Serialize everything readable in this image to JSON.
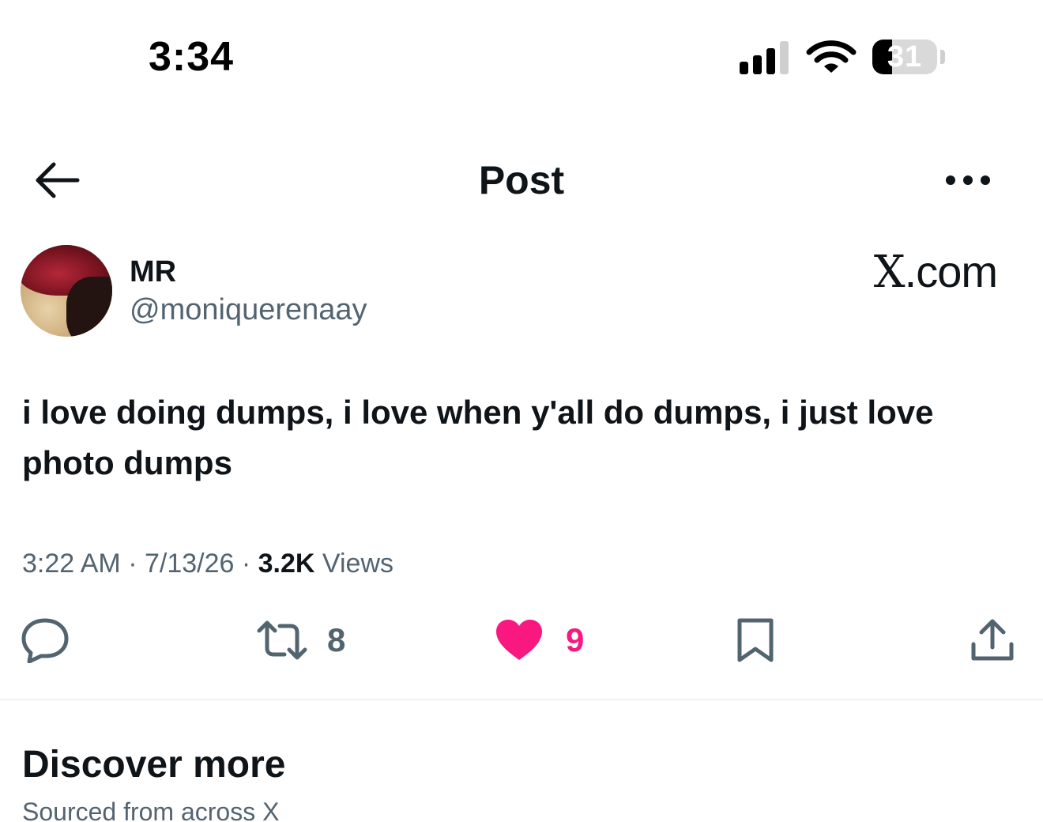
{
  "status_bar": {
    "time": "3:34",
    "battery_level": "31"
  },
  "header": {
    "title": "Post"
  },
  "author": {
    "name": "MR",
    "handle": "@moniquerenaay"
  },
  "source": {
    "mark": "X",
    "suffix": ".com"
  },
  "tweet": {
    "text": "i love doing dumps, i love when y'all do dumps, i just love photo dumps",
    "time": "3:22 AM",
    "date": "7/13/26",
    "separator": " · ",
    "views_count": "3.2K",
    "views_label": " Views"
  },
  "actions": {
    "reposts": "8",
    "likes": "9"
  },
  "discover": {
    "title": "Discover more",
    "subtitle": "Sourced from across X"
  },
  "colors": {
    "like": "#f91880",
    "muted": "#536471",
    "text": "#0f1419"
  }
}
